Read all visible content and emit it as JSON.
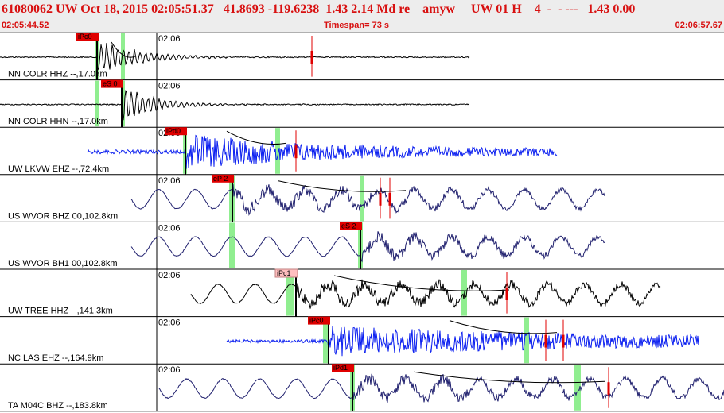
{
  "header": {
    "event_line": "61080062 UW Oct 18, 2015 02:05:51.37   41.8693 -119.6238  1.43 2.14 Md re    amyw     UW 01 H    4  -  - ---   1.43 0.00",
    "time_start": "02:05:44.52",
    "timespan": "Timespan= 73 s",
    "time_end": "02:06:57.67"
  },
  "tick_label": "02:06",
  "colors": {
    "header_text": "#d81010",
    "trace_black": "#000000",
    "trace_blue": "#0a1ef0",
    "trace_navy": "#20206e",
    "window_green": "#90ee90",
    "pick_red": "#e00000",
    "pick_pink": "#ffbfbf"
  },
  "traces": [
    {
      "label": "NN COLR HHZ --,17.0km",
      "color": "black",
      "pick": "iPc0",
      "pick_style": "red"
    },
    {
      "label": "NN COLR HHN --,17.0km",
      "color": "black",
      "pick": "eS 0",
      "pick_style": "red"
    },
    {
      "label": "UW LKVW EHZ --,72.4km",
      "color": "blue",
      "pick": "iPd0",
      "pick_style": "red"
    },
    {
      "label": "US WVOR BHZ 00,102.8km",
      "color": "navy",
      "pick": "eP 2",
      "pick_style": "red"
    },
    {
      "label": "US WVOR BH1 00,102.8km",
      "color": "navy",
      "pick": "eS 2",
      "pick_style": "red"
    },
    {
      "label": "UW TREE HHZ --,141.3km",
      "color": "black",
      "pick": "iPc1",
      "pick_style": "pink"
    },
    {
      "label": "NC LAS EHZ --,164.9km",
      "color": "blue",
      "pick": "iPc0",
      "pick_style": "red"
    },
    {
      "label": "TA M04C BHZ --,183.8km",
      "color": "navy",
      "pick": "iPd1",
      "pick_style": "red"
    }
  ]
}
